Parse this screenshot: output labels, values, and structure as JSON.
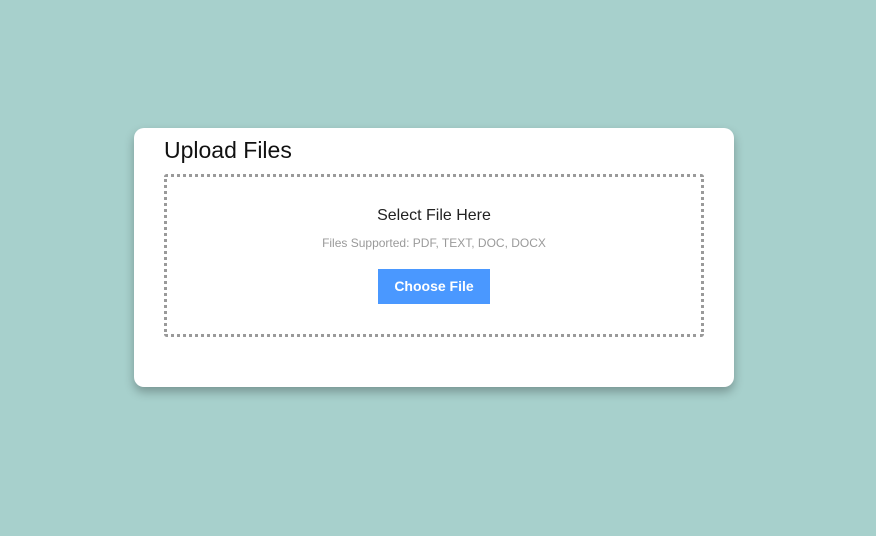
{
  "upload": {
    "title": "Upload Files",
    "drop_heading": "Select File Here",
    "supported_text": "Files Supported: PDF, TEXT, DOC, DOCX",
    "choose_button_label": "Choose File"
  },
  "colors": {
    "background": "#a7d0cc",
    "card": "#ffffff",
    "button": "#4a98ff",
    "button_text": "#ffffff",
    "dotted_border": "#9a9a9a",
    "muted_text": "#9a9a9a"
  }
}
